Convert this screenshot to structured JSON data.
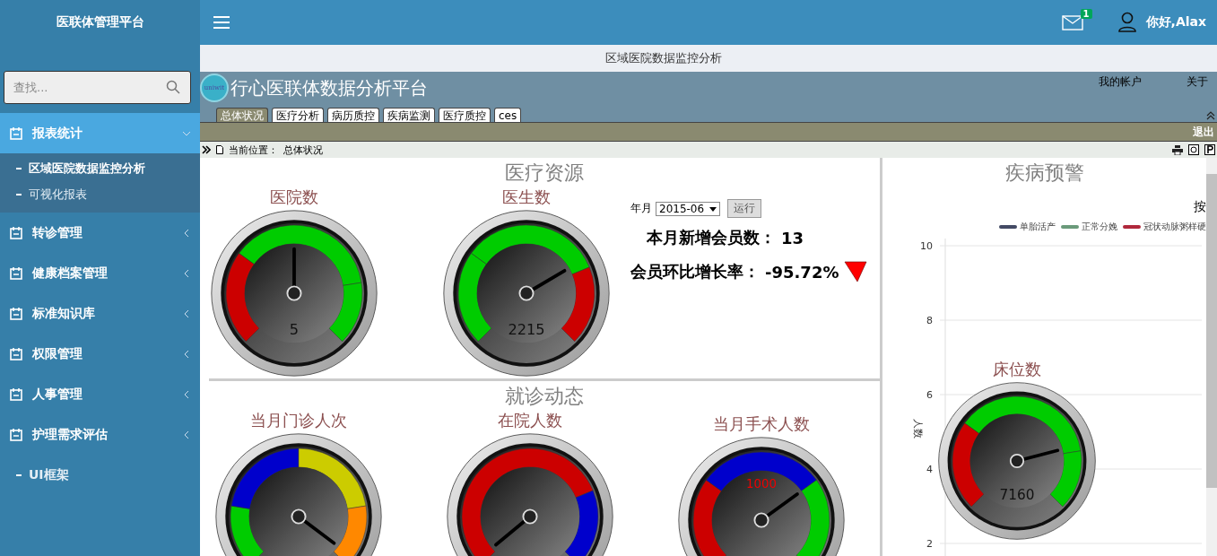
{
  "sidebar": {
    "title": "医联体管理平台",
    "search": {
      "placeholder": "查找..."
    },
    "items": [
      {
        "label": "报表统计",
        "expanded": true,
        "selected": true,
        "children": [
          {
            "label": "区域医院数据监控分析",
            "selected": true
          },
          {
            "label": "可视化报表",
            "selected": false
          }
        ]
      },
      {
        "label": "转诊管理",
        "expanded": false,
        "selected": false
      },
      {
        "label": "健康档案管理",
        "expanded": false,
        "selected": false
      },
      {
        "label": "标准知识库",
        "expanded": false,
        "selected": false
      },
      {
        "label": "权限管理",
        "expanded": false,
        "selected": false
      },
      {
        "label": "人事管理",
        "expanded": false,
        "selected": false
      },
      {
        "label": "护理需求评估",
        "expanded": false,
        "selected": false
      }
    ],
    "footer_link": "UI框架"
  },
  "header": {
    "mail_badge": "1",
    "greeting": "你好,Alax"
  },
  "page_tab": "区域医院数据监控分析",
  "report": {
    "logo_text": "uniwit",
    "title": "行心医联体数据分析平台",
    "links": [
      "我的帐户",
      "关于"
    ],
    "tabs": [
      {
        "label": "总体状况",
        "selected": true
      },
      {
        "label": "医疗分析",
        "selected": false
      },
      {
        "label": "病历质控",
        "selected": false
      },
      {
        "label": "疾病监测",
        "selected": false
      },
      {
        "label": "医疗质控",
        "selected": false
      },
      {
        "label": "ces",
        "selected": false
      }
    ],
    "logout": "退出",
    "location_label": "当前位置：",
    "location": "总体状况"
  },
  "resources": {
    "title": "医疗资源",
    "gauges": [
      {
        "title": "医院数",
        "reading": "5"
      },
      {
        "title": "医生数",
        "reading": "2215"
      }
    ],
    "period_label": "年月",
    "period": "2015-06",
    "run_button": "运行",
    "stats": [
      {
        "label": "本月新增会员数：",
        "value": "13"
      },
      {
        "label": "会员环比增长率：",
        "value": "-95.72%"
      }
    ]
  },
  "visits": {
    "title": "就诊动态",
    "gauges": [
      {
        "title": "当月门诊人次"
      },
      {
        "title": "在院人数"
      },
      {
        "title": "当月手术人数",
        "reading": "1000"
      }
    ]
  },
  "warning": {
    "title": "疾病预警",
    "subtitle": "按",
    "chart_data": {
      "type": "line",
      "ylabel": "人数",
      "grid": true,
      "ylim": [
        1.5,
        10
      ],
      "yticks": [
        2,
        4,
        6,
        8,
        10
      ],
      "series": [
        {
          "name": "单胎活产",
          "color": "#434a64"
        },
        {
          "name": "正常分娩",
          "color": "#6a9a7a"
        },
        {
          "name": "冠状动脉粥样硬",
          "color": "#b0283c"
        }
      ]
    },
    "bed_gauge": {
      "title": "床位数",
      "reading": "7160"
    }
  }
}
